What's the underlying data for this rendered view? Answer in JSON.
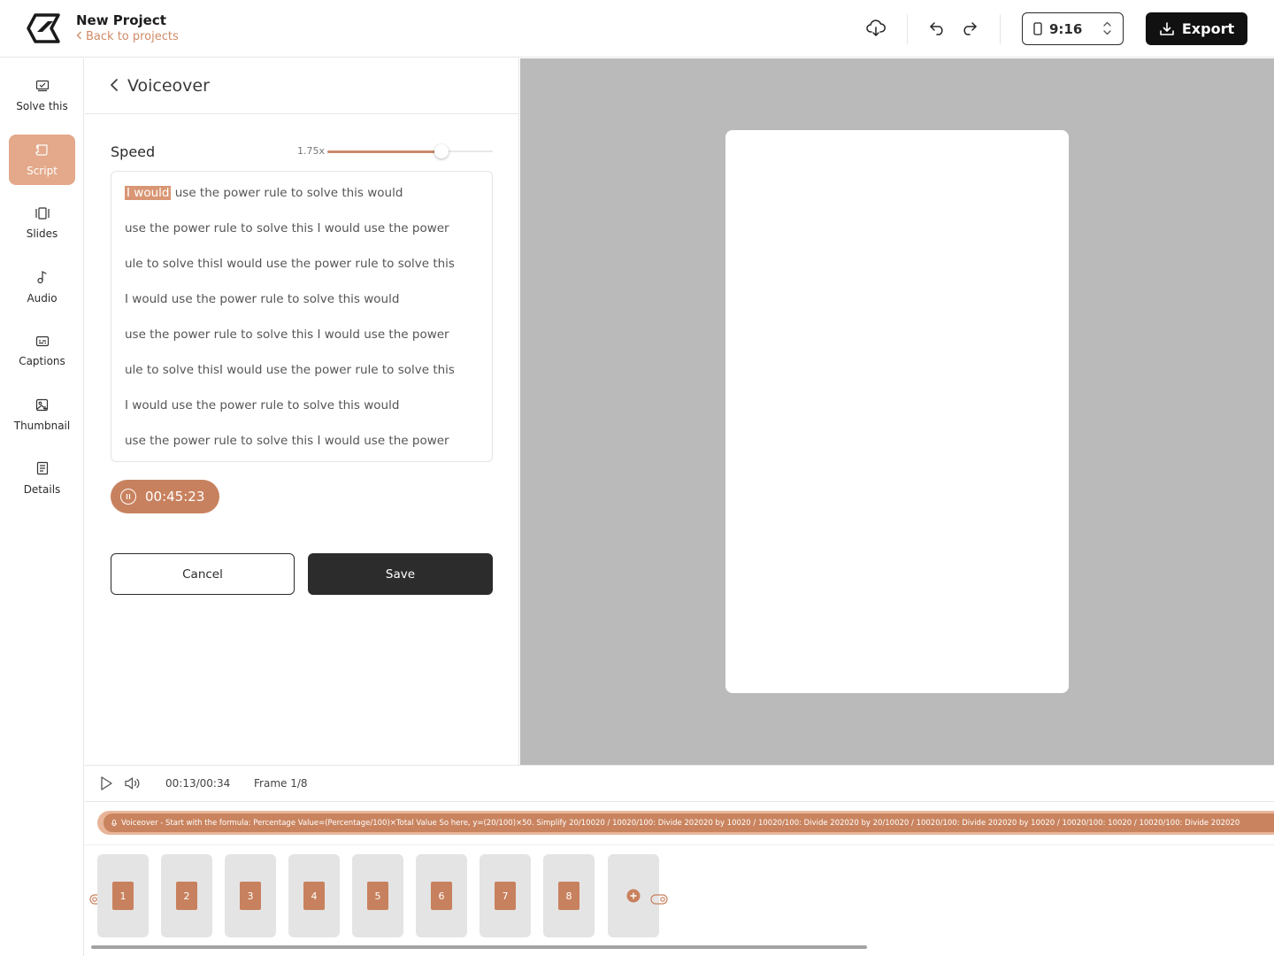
{
  "header": {
    "project_title": "New Project",
    "back_label": "Back to projects",
    "aspect_ratio": "9:16",
    "export_label": "Export"
  },
  "sidebar": {
    "items": [
      {
        "label": "Solve this",
        "icon": "checkbox-icon"
      },
      {
        "label": "Script",
        "icon": "script-icon",
        "active": true
      },
      {
        "label": "Slides",
        "icon": "slides-icon"
      },
      {
        "label": "Audio",
        "icon": "music-note-icon"
      },
      {
        "label": "Captions",
        "icon": "captions-icon"
      },
      {
        "label": "Thumbnail",
        "icon": "image-icon"
      },
      {
        "label": "Details",
        "icon": "document-icon"
      }
    ]
  },
  "panel": {
    "title": "Voiceover",
    "speed_label": "Speed",
    "speed_value": "1.75x",
    "speed_fraction": 0.69,
    "highlight": "I would",
    "first_line_rest": " use the power rule to solve this would",
    "lines": [
      "use the power rule to solve this I would use the power r",
      "ule to solve thisI would use the power rule to solve thisI",
      "I would use the power rule to solve this would",
      "use the power rule to solve this I would use the power r",
      "ule to solve thisI would use the power rule to solve thisI",
      "I would use the power rule to solve this would",
      "use the power rule to solve this I would use the power r"
    ],
    "timer": "00:45:23",
    "cancel_label": "Cancel",
    "save_label": "Save"
  },
  "timeline": {
    "time": "00:13/00:34",
    "frame": "Frame 1/8",
    "voiceover_text": "Voiceover - Start with the formula: Percentage Value=(Percentage/100)×Total Value So here, y=(20/100)×50. Simplify 20/10020 / 10020/100: Divide 202020 by  10020 / 10020/100: Divide 202020 by 20/10020 / 10020/100: Divide 202020 by  10020 / 10020/100:  10020 / 10020/100: Divide 202020",
    "slides": [
      "1",
      "2",
      "3",
      "4",
      "5",
      "6",
      "7",
      "8"
    ]
  },
  "colors": {
    "accent": "#c8815e",
    "accent_light": "#e3a98a",
    "canvas_bg": "#bababa"
  }
}
